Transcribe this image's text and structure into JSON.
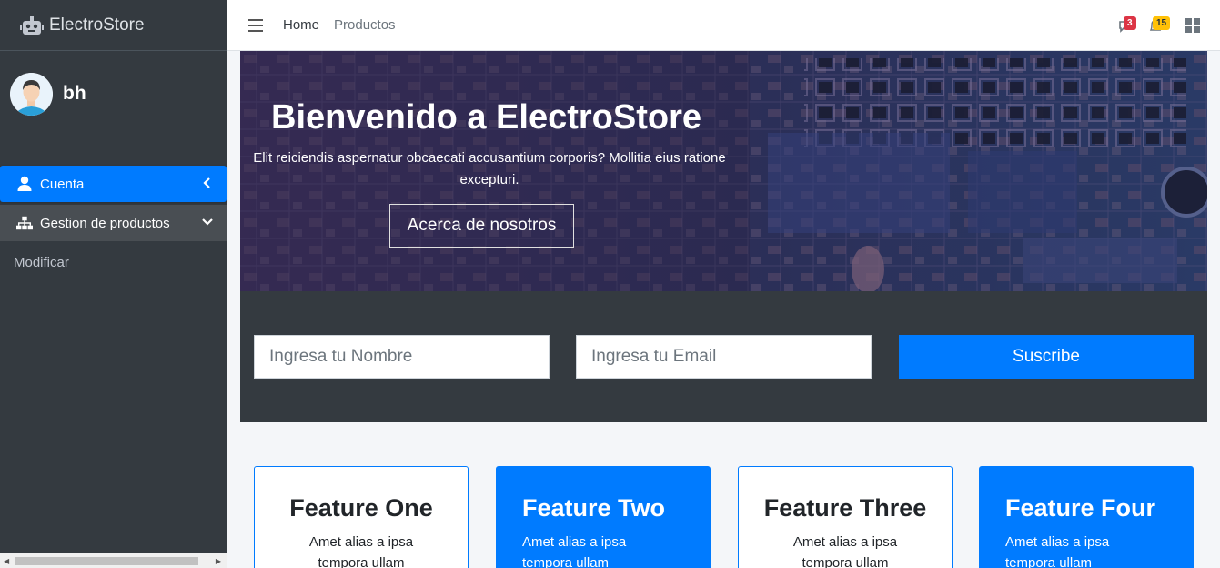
{
  "brand": {
    "name": "ElectroStore",
    "icon": "robot-icon"
  },
  "user": {
    "name": "bh"
  },
  "sidebar": {
    "items": [
      {
        "label": "Cuenta",
        "icon": "user-icon",
        "state": "active"
      },
      {
        "label": "Gestion de productos",
        "icon": "sitemap-icon",
        "state": "open"
      }
    ],
    "subitems": [
      {
        "label": "Modificar"
      }
    ]
  },
  "topbar": {
    "links": [
      "Home",
      "Productos"
    ],
    "notifications": {
      "messages": "3",
      "alerts": "15"
    }
  },
  "hero": {
    "title": "Bienvenido a ElectroStore",
    "text": "Elit reiciendis aspernatur obcaecati accusantium corporis? Mollitia eius ratione excepturi.",
    "button": "Acerca de nosotros"
  },
  "subscribe": {
    "name_placeholder": "Ingresa tu Nombre",
    "email_placeholder": "Ingresa tu Email",
    "button": "Suscribe"
  },
  "features": [
    {
      "title": "Feature One",
      "text": "Amet alias a ipsa tempora ullam",
      "style": "white"
    },
    {
      "title": "Feature Two",
      "text": "Amet alias a ipsa tempora ullam",
      "style": "blue"
    },
    {
      "title": "Feature Three",
      "text": "Amet alias a ipsa tempora ullam",
      "style": "white"
    },
    {
      "title": "Feature Four",
      "text": "Amet alias a ipsa tempora ullam",
      "style": "blue"
    }
  ],
  "colors": {
    "primary": "#007bff",
    "sidebar": "#343a40",
    "danger": "#dc3545",
    "warning": "#ffc107"
  }
}
